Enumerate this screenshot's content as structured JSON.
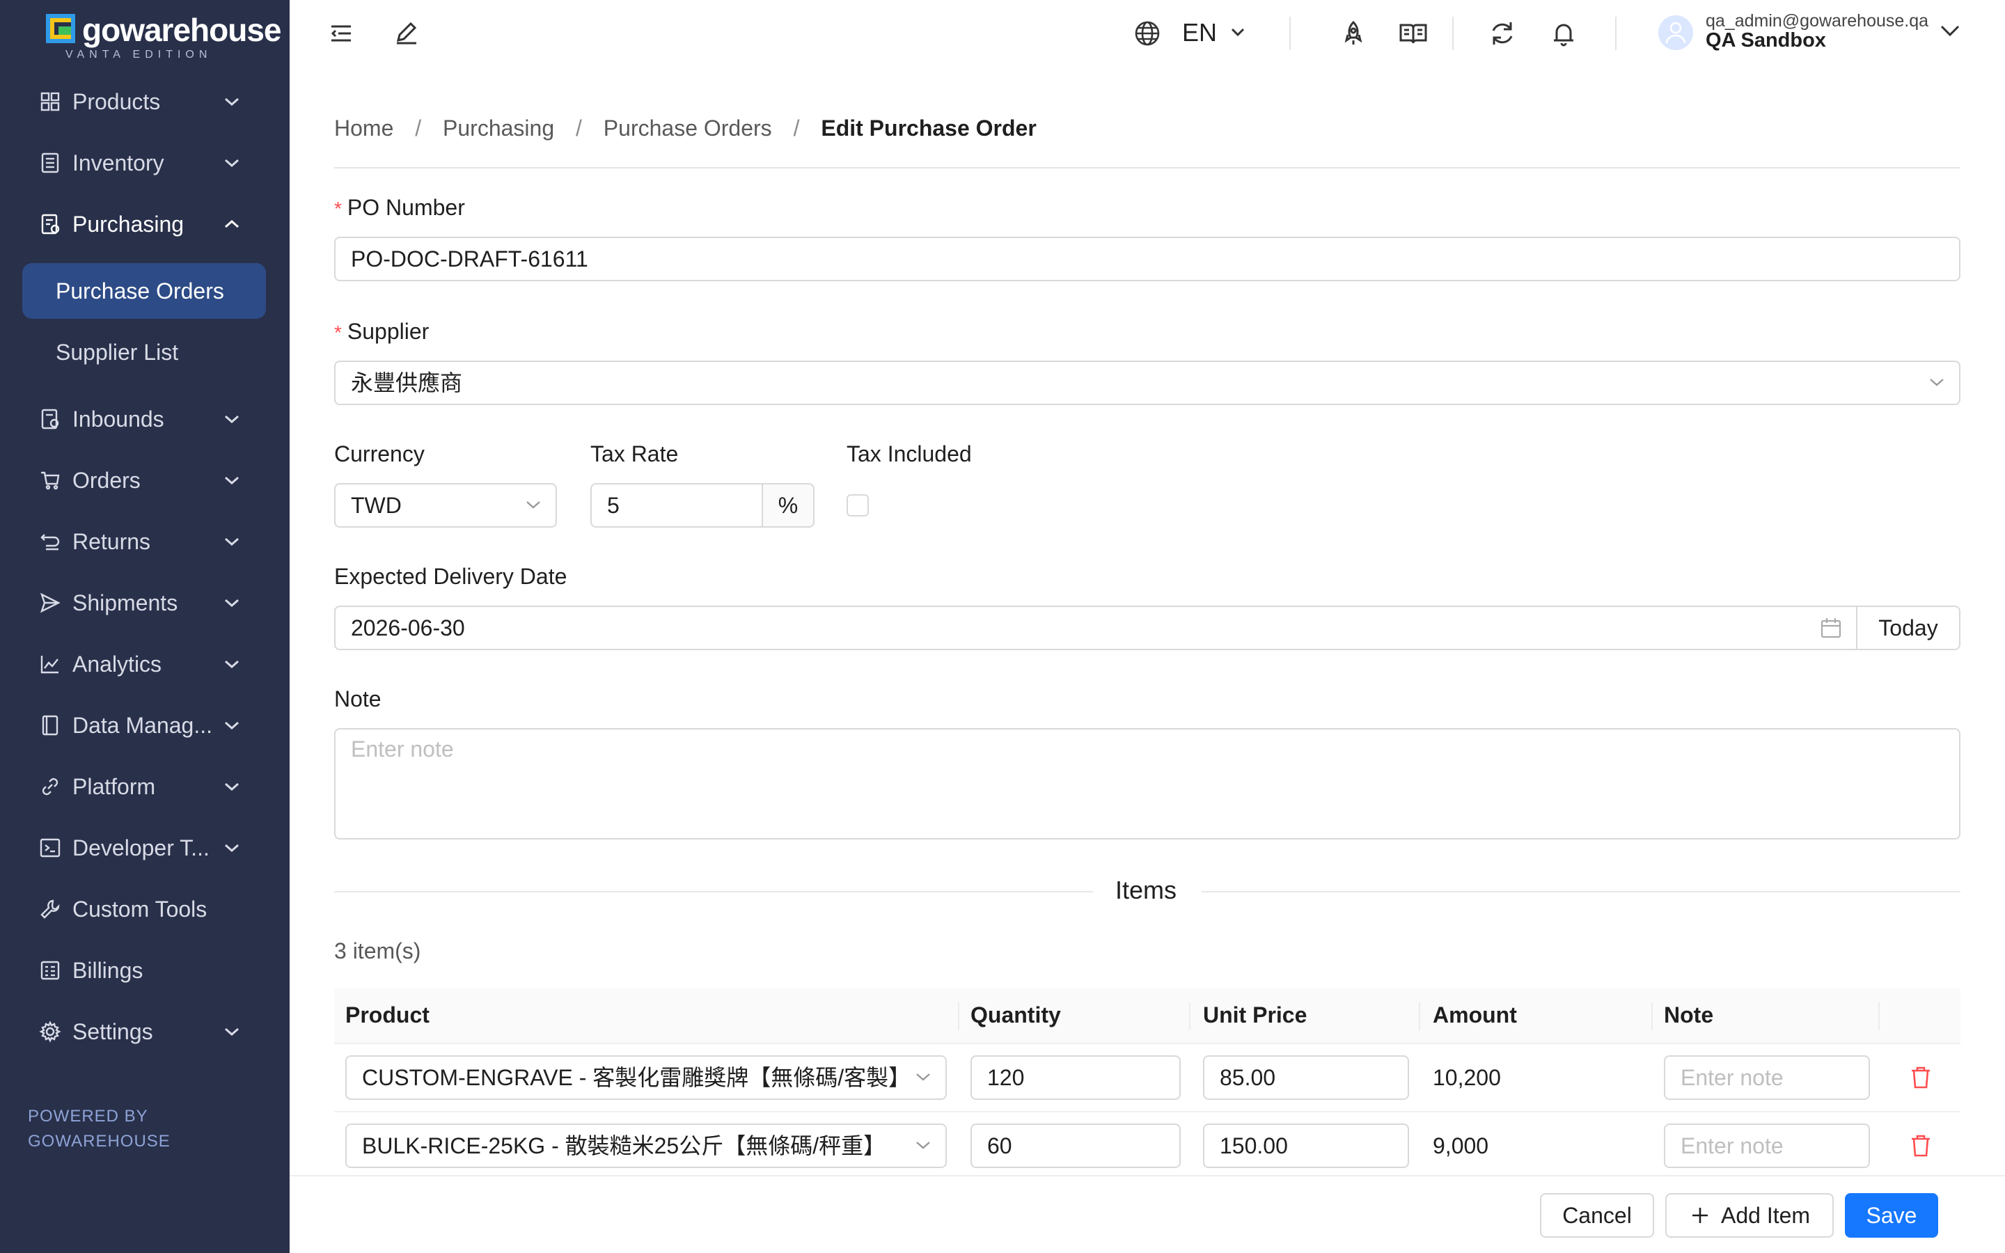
{
  "brand": {
    "name": "gowarehouse",
    "edition": "VANTA EDITION",
    "colors": {
      "sidebar": "#29304a",
      "active": "#2d4b86",
      "primary": "#1677ff",
      "danger": "#ff4d4f"
    }
  },
  "sidebar": {
    "items": [
      {
        "label": "Products",
        "icon": "grid-icon"
      },
      {
        "label": "Inventory",
        "icon": "inventory-icon"
      },
      {
        "label": "Purchasing",
        "icon": "purchasing-icon"
      },
      {
        "label": "Inbounds",
        "icon": "inbound-icon"
      },
      {
        "label": "Orders",
        "icon": "cart-icon"
      },
      {
        "label": "Returns",
        "icon": "return-icon"
      },
      {
        "label": "Shipments",
        "icon": "send-icon"
      },
      {
        "label": "Analytics",
        "icon": "line-chart-icon"
      },
      {
        "label": "Data Manag...",
        "icon": "book-icon"
      },
      {
        "label": "Platform",
        "icon": "link-icon"
      },
      {
        "label": "Developer T...",
        "icon": "terminal-icon"
      },
      {
        "label": "Custom Tools",
        "icon": "tool-icon"
      },
      {
        "label": "Billings",
        "icon": "billing-icon"
      },
      {
        "label": "Settings",
        "icon": "gear-icon"
      }
    ],
    "subitems": [
      {
        "label": "Purchase Orders"
      },
      {
        "label": "Supplier List"
      }
    ],
    "powered_line1": "POWERED BY",
    "powered_line2": "GOWAREHOUSE"
  },
  "topbar": {
    "language": "EN",
    "user_email": "qa_admin@gowarehouse.qa",
    "user_org": "QA Sandbox"
  },
  "breadcrumb": [
    "Home",
    "Purchasing",
    "Purchase Orders",
    "Edit Purchase Order"
  ],
  "form": {
    "po_number_label": "PO Number",
    "po_number": "PO-DOC-DRAFT-61611",
    "supplier_label": "Supplier",
    "supplier": "永豐供應商",
    "currency_label": "Currency",
    "currency": "TWD",
    "tax_rate_label": "Tax Rate",
    "tax_rate": "5",
    "tax_unit": "%",
    "tax_included_label": "Tax Included",
    "tax_included": false,
    "delivery_label": "Expected Delivery Date",
    "delivery_date": "2026-06-30",
    "today_label": "Today",
    "note_label": "Note",
    "note_placeholder": "Enter note"
  },
  "items": {
    "title": "Items",
    "count": "3 item(s)",
    "columns": [
      "Product",
      "Quantity",
      "Unit Price",
      "Amount",
      "Note"
    ],
    "rows": [
      {
        "product": "CUSTOM-ENGRAVE - 客製化雷雕獎牌【無條碼/客製】",
        "quantity": "120",
        "unit_price": "85.00",
        "amount": "10,200",
        "note_placeholder": "Enter note"
      },
      {
        "product": "BULK-RICE-25KG - 散裝糙米25公斤【無條碼/秤重】",
        "quantity": "60",
        "unit_price": "150.00",
        "amount": "9,000",
        "note_placeholder": "Enter note"
      }
    ]
  },
  "footer": {
    "cancel": "Cancel",
    "add_item": "Add Item",
    "save": "Save"
  }
}
